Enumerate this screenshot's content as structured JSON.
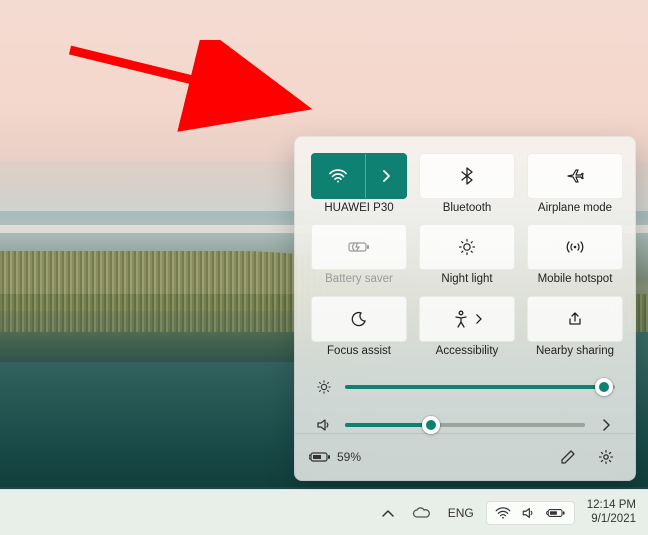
{
  "tiles": {
    "wifi": {
      "label": "HUAWEI P30"
    },
    "bluetooth": {
      "label": "Bluetooth"
    },
    "airplane": {
      "label": "Airplane mode"
    },
    "battery": {
      "label": "Battery saver"
    },
    "night": {
      "label": "Night light"
    },
    "hotspot": {
      "label": "Mobile hotspot"
    },
    "focus": {
      "label": "Focus assist"
    },
    "access": {
      "label": "Accessibility"
    },
    "nearby": {
      "label": "Nearby sharing"
    }
  },
  "sliders": {
    "brightness": {
      "percent": 96
    },
    "volume": {
      "percent": 36
    }
  },
  "footer": {
    "battery_text": "59%"
  },
  "taskbar": {
    "lang": "ENG",
    "time": "12:14 PM",
    "date": "9/1/2021"
  }
}
